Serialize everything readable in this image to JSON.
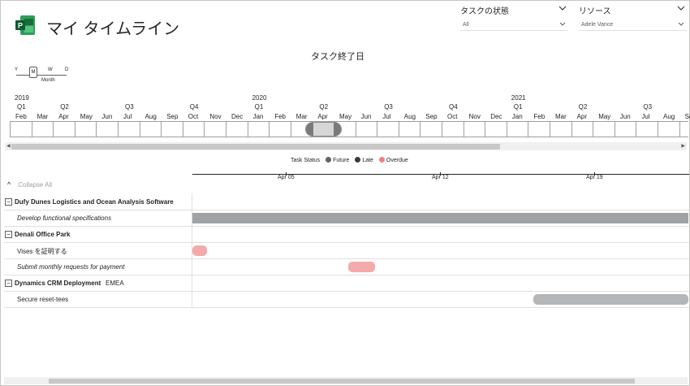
{
  "app": {
    "title": "マイ タイムライン"
  },
  "filters": [
    {
      "title": "タスクの状態",
      "value": "All"
    },
    {
      "title": "リソース",
      "value": "Adele Vance"
    }
  ],
  "chart_title": "タスク終了日",
  "zoom": {
    "levels": [
      "Y",
      "M",
      "W",
      "D"
    ],
    "selected": "M",
    "label": "Month"
  },
  "overview": {
    "years": [
      {
        "label": "2019",
        "pos": 0
      },
      {
        "label": "2020",
        "pos": 11
      },
      {
        "label": "2021",
        "pos": 23
      }
    ],
    "quarters": [
      {
        "label": "Q1",
        "pos": 0
      },
      {
        "label": "Q2",
        "pos": 2
      },
      {
        "label": "Q3",
        "pos": 5
      },
      {
        "label": "Q4",
        "pos": 8
      },
      {
        "label": "Q1",
        "pos": 11
      },
      {
        "label": "Q2",
        "pos": 14
      },
      {
        "label": "Q3",
        "pos": 17
      },
      {
        "label": "Q4",
        "pos": 20
      },
      {
        "label": "Q1",
        "pos": 23
      },
      {
        "label": "Q2",
        "pos": 26
      },
      {
        "label": "Q3",
        "pos": 29
      }
    ],
    "months": [
      "Feb",
      "Mar",
      "Apr",
      "May",
      "Jun",
      "Jul",
      "Aug",
      "Sep",
      "Oct",
      "Nov",
      "Dec",
      "Jan",
      "Feb",
      "Mar",
      "Apr",
      "May",
      "Jun",
      "Jul",
      "Aug",
      "Sep",
      "Oct",
      "Nov",
      "Dec",
      "Jan",
      "Feb",
      "Mar",
      "Apr",
      "May",
      "Jun",
      "Jul",
      "Aug",
      "Sep"
    ],
    "last_month_partial": "S"
  },
  "legend": {
    "title": "Task Status",
    "items": [
      {
        "label": "Future",
        "color": "#5f6368"
      },
      {
        "label": "Late",
        "color": "#3b3b3b"
      },
      {
        "label": "Overdue",
        "color": "#f07f7f"
      }
    ]
  },
  "gantt": {
    "collapse_label": "Collapse All",
    "axis_ticks": [
      "Apr 05",
      "Apr 12",
      "Apr 19"
    ],
    "rows": [
      {
        "type": "group",
        "label": "Dufy Dunes Logistics and Ocean Analysis Software"
      },
      {
        "type": "task",
        "label": "Develop functional specifications",
        "status": "Future",
        "bar": {
          "start": 0.0,
          "end": 1.0
        },
        "color": "#a0a3a5"
      },
      {
        "type": "group",
        "label": "Denali Office Park"
      },
      {
        "type": "plain",
        "label": "Vises を証明する",
        "status": "Overdue",
        "bar": {
          "start": 0.0,
          "end": 0.03
        },
        "color": "#f4aaaa"
      },
      {
        "type": "task",
        "label": "Submit monthly requests for payment",
        "status": "Overdue",
        "bar": {
          "start": 0.315,
          "end": 0.368
        },
        "color": "#f4aaaa"
      },
      {
        "type": "group",
        "label": "Dynamics CRM Deployment",
        "suffix": "EMEA"
      },
      {
        "type": "plain",
        "label": "Secure reset-tees",
        "status": "Future",
        "bar": {
          "start": 0.688,
          "end": 1.0
        },
        "color": "#b4b6b8"
      }
    ]
  }
}
